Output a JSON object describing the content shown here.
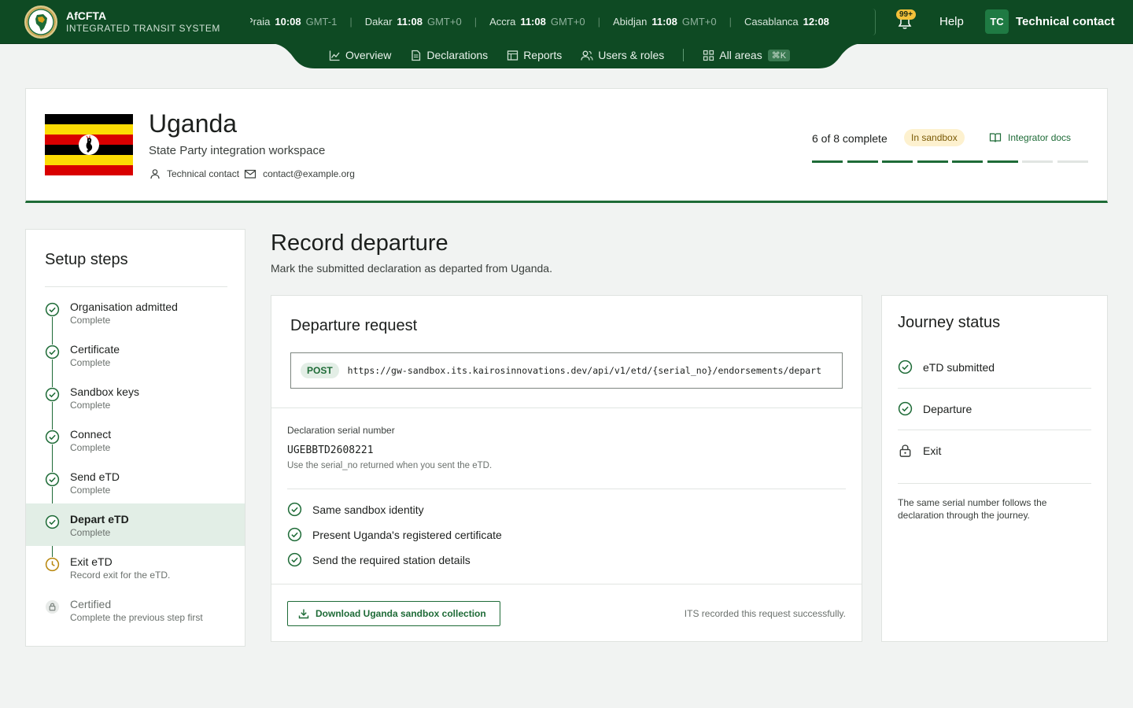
{
  "brand": {
    "name": "AfCFTA",
    "subtitle": "INTEGRATED TRANSIT SYSTEM",
    "logo_text": "AfCFTA"
  },
  "clocks": [
    {
      "city": "Praia",
      "time": "10:08",
      "gmt": "GMT-1"
    },
    {
      "city": "Dakar",
      "time": "11:08",
      "gmt": "GMT+0"
    },
    {
      "city": "Accra",
      "time": "11:08",
      "gmt": "GMT+0"
    },
    {
      "city": "Abidjan",
      "time": "11:08",
      "gmt": "GMT+0"
    },
    {
      "city": "Casablanca",
      "time": "12:08",
      "gmt": ""
    }
  ],
  "header": {
    "notifications_badge": "99+",
    "help_label": "Help",
    "avatar_initials": "TC",
    "user_name": "Technical contact"
  },
  "nav": {
    "items": [
      {
        "label": "Overview",
        "icon": "chart-line-icon"
      },
      {
        "label": "Declarations",
        "icon": "document-icon"
      },
      {
        "label": "Reports",
        "icon": "table-icon"
      },
      {
        "label": "Users & roles",
        "icon": "users-icon"
      }
    ],
    "all_areas_label": "All areas",
    "all_areas_shortcut": "⌘K"
  },
  "country": {
    "name": "Uganda",
    "subtitle": "State Party integration workspace",
    "contact_name": "Technical contact",
    "contact_email": "contact@example.org",
    "progress_text": "6 of 8 complete",
    "progress_completed": 6,
    "progress_total": 8,
    "sandbox_label": "In sandbox",
    "docs_label": "Integrator docs"
  },
  "sidebar": {
    "title": "Setup steps",
    "steps": [
      {
        "name": "Organisation admitted",
        "state": "Complete",
        "status": "done"
      },
      {
        "name": "Certificate",
        "state": "Complete",
        "status": "done"
      },
      {
        "name": "Sandbox keys",
        "state": "Complete",
        "status": "done"
      },
      {
        "name": "Connect",
        "state": "Complete",
        "status": "done"
      },
      {
        "name": "Send eTD",
        "state": "Complete",
        "status": "done"
      },
      {
        "name": "Depart eTD",
        "state": "Complete",
        "status": "done"
      },
      {
        "name": "Exit eTD",
        "state": "Record exit for the eTD.",
        "status": "pending"
      },
      {
        "name": "Certified",
        "state": "Complete the previous step first",
        "status": "locked"
      }
    ]
  },
  "main": {
    "title": "Record departure",
    "subtitle": "Mark the submitted declaration as departed from Uganda.",
    "request": {
      "title": "Departure request",
      "method": "POST",
      "url": "https://gw-sandbox.its.kairosinnovations.dev/api/v1/etd/{serial_no}/endorsements/depart",
      "field_label": "Declaration serial number",
      "field_value": "UGEBBTD2608221",
      "field_hint": "Use the serial_no returned when you sent the eTD.",
      "checks": [
        "Same sandbox identity",
        "Present Uganda's registered certificate",
        "Send the required station details"
      ],
      "download_label": "Download Uganda sandbox collection",
      "status_message": "ITS recorded this request successfully."
    }
  },
  "journey": {
    "title": "Journey status",
    "items": [
      {
        "label": "eTD submitted",
        "status": "done"
      },
      {
        "label": "Departure",
        "status": "done"
      },
      {
        "label": "Exit",
        "status": "locked"
      }
    ],
    "note": "The same serial number follows the declaration through the journey."
  },
  "colors": {
    "brand_green": "#0e4a23",
    "accent_green": "#1e6b37",
    "pending_gold": "#b8860b",
    "sandbox_bg": "#fdf1cf"
  }
}
